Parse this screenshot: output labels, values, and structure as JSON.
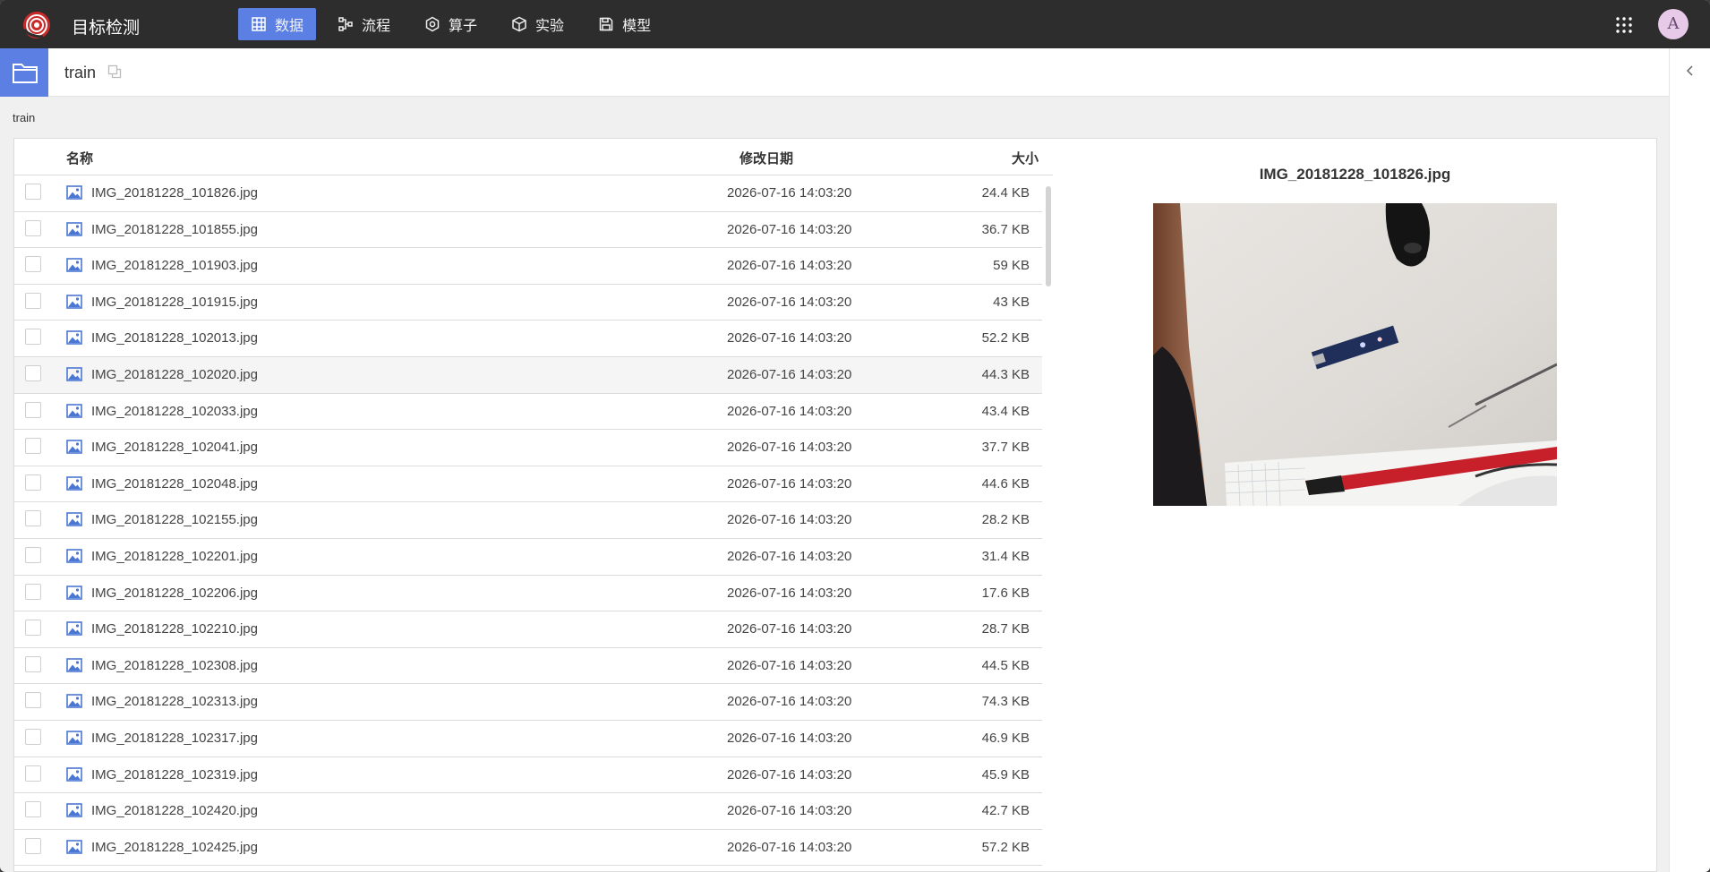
{
  "app": {
    "title": "目标检测",
    "avatar_letter": "A"
  },
  "nav": [
    {
      "label": "数据",
      "icon": "table-icon",
      "active": true
    },
    {
      "label": "流程",
      "icon": "flow-icon",
      "active": false
    },
    {
      "label": "算子",
      "icon": "operator-icon",
      "active": false
    },
    {
      "label": "实验",
      "icon": "cube-icon",
      "active": false
    },
    {
      "label": "模型",
      "icon": "save-icon",
      "active": false
    }
  ],
  "folder": {
    "name": "train"
  },
  "breadcrumb": "train",
  "list": {
    "headers": {
      "name": "名称",
      "date": "修改日期",
      "size": "大小"
    },
    "files": [
      {
        "name": "IMG_20181228_101826.jpg",
        "date": "2026-07-16 14:03:20",
        "size": "24.4 KB"
      },
      {
        "name": "IMG_20181228_101855.jpg",
        "date": "2026-07-16 14:03:20",
        "size": "36.7 KB"
      },
      {
        "name": "IMG_20181228_101903.jpg",
        "date": "2026-07-16 14:03:20",
        "size": "59 KB"
      },
      {
        "name": "IMG_20181228_101915.jpg",
        "date": "2026-07-16 14:03:20",
        "size": "43 KB"
      },
      {
        "name": "IMG_20181228_102013.jpg",
        "date": "2026-07-16 14:03:20",
        "size": "52.2 KB"
      },
      {
        "name": "IMG_20181228_102020.jpg",
        "date": "2026-07-16 14:03:20",
        "size": "44.3 KB"
      },
      {
        "name": "IMG_20181228_102033.jpg",
        "date": "2026-07-16 14:03:20",
        "size": "43.4 KB"
      },
      {
        "name": "IMG_20181228_102041.jpg",
        "date": "2026-07-16 14:03:20",
        "size": "37.7 KB"
      },
      {
        "name": "IMG_20181228_102048.jpg",
        "date": "2026-07-16 14:03:20",
        "size": "44.6 KB"
      },
      {
        "name": "IMG_20181228_102155.jpg",
        "date": "2026-07-16 14:03:20",
        "size": "28.2 KB"
      },
      {
        "name": "IMG_20181228_102201.jpg",
        "date": "2026-07-16 14:03:20",
        "size": "31.4 KB"
      },
      {
        "name": "IMG_20181228_102206.jpg",
        "date": "2026-07-16 14:03:20",
        "size": "17.6 KB"
      },
      {
        "name": "IMG_20181228_102210.jpg",
        "date": "2026-07-16 14:03:20",
        "size": "28.7 KB"
      },
      {
        "name": "IMG_20181228_102308.jpg",
        "date": "2026-07-16 14:03:20",
        "size": "44.5 KB"
      },
      {
        "name": "IMG_20181228_102313.jpg",
        "date": "2026-07-16 14:03:20",
        "size": "74.3 KB"
      },
      {
        "name": "IMG_20181228_102317.jpg",
        "date": "2026-07-16 14:03:20",
        "size": "46.9 KB"
      },
      {
        "name": "IMG_20181228_102319.jpg",
        "date": "2026-07-16 14:03:20",
        "size": "45.9 KB"
      },
      {
        "name": "IMG_20181228_102420.jpg",
        "date": "2026-07-16 14:03:20",
        "size": "42.7 KB"
      },
      {
        "name": "IMG_20181228_102425.jpg",
        "date": "2026-07-16 14:03:20",
        "size": "57.2 KB"
      }
    ]
  },
  "preview": {
    "title": "IMG_20181228_101826.jpg"
  },
  "colors": {
    "topbar": "#2d2d2d",
    "accent": "#5b7fe3",
    "icon_blue": "#4a77d4"
  }
}
